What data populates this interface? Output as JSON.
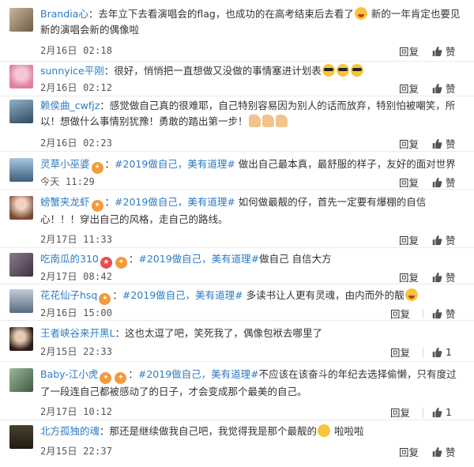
{
  "colors": {
    "link": "#2e7bc2",
    "text": "#333333",
    "date": "#555555",
    "badge": "#f39a3a"
  },
  "comments": [
    {
      "user": "Brandia心",
      "text": "去年立下去看演唱会的flag，也成功的在高考结束后去看了",
      "text2": "新的一年肯定也要见新的演唱会新的偶像啦",
      "emoji": "grin-emoji",
      "date": "2月16日 02:18",
      "reply": "回复",
      "like": "赞"
    },
    {
      "user": "sunnyice平刚",
      "text": "很好，悄悄把一直想做又没做的事情塞进计划表",
      "emoji": "sunglasses-emoji x3",
      "date": "2月16日 02:12",
      "reply": "回复",
      "like": "赞"
    },
    {
      "user": "赖侯曲_cwfjz",
      "text": "感觉做自己真的很难耶，自己特别容易因为别人的话而放弃，特别怕被嘲笑，所以！想做什么事情别犹豫！勇敢的踏出第一步！",
      "emoji": "flexed-arm-emoji x3",
      "date": "2月16日 02:23",
      "reply": "回复",
      "like": "赞"
    },
    {
      "user": "灵草小巫婆",
      "tag": "#2019做自己，美有道理#",
      "text": "做出自己最本真，最舒服的样子，友好的面对世界",
      "date": "今天 11:29",
      "reply": "回复",
      "like": "赞"
    },
    {
      "user": "螃蟹夹龙虾",
      "tag": "#2019做自己，美有道理#",
      "text": "如何做最靓的仔，首先一定要有爆棚的自信心！！！穿出自己的风格，走自己的路线。",
      "date": "2月17日 11:33",
      "reply": "回复",
      "like": "赞"
    },
    {
      "user": "吃南瓜的310",
      "tag": "#2019做自己，美有道理#",
      "text": "做自己 自信大方",
      "date": "2月17日 08:42",
      "reply": "回复",
      "like": "赞"
    },
    {
      "user": "花花仙子hsq",
      "tag": "#2019做自己，美有道理#",
      "text": "多读书让人更有灵魂，由内而外的靓",
      "emoji": "laugh-emoji",
      "date": "2月16日 15:00",
      "reply": "回复",
      "like": "赞"
    },
    {
      "user": "王者峡谷来开黑L",
      "text": "这也太逗了吧，笑死我了，偶像包袱去哪里了",
      "date": "2月15日 22:33",
      "reply": "回复",
      "like": "1"
    },
    {
      "user": "Baby-江小虎",
      "tag": "#2019做自己，美有道理#",
      "text": "不应该在该奋斗的年纪去选择偷懒，只有度过了一段连自己都被感动了的日子，才会变成那个最美的自己。",
      "date": "2月17日 10:12",
      "reply": "回复",
      "like": "1"
    },
    {
      "user": "北方孤独的魂",
      "text": "那还是继续做我自己吧，我觉得我是那个最靓的",
      "text2": "啦啦啦",
      "emoji": "smile-emoji",
      "date": "2月15日 22:37",
      "reply": "回复",
      "like": "赞"
    }
  ]
}
